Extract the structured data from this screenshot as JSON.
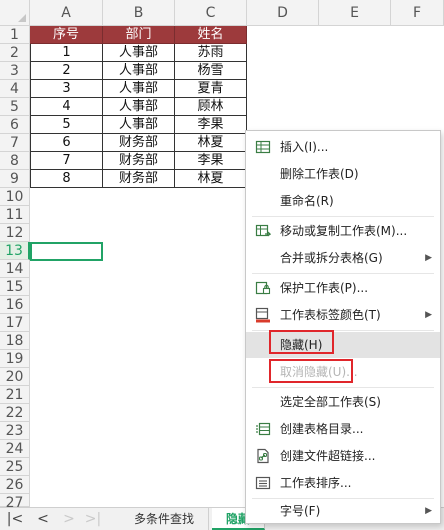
{
  "columns": [
    "A",
    "B",
    "C",
    "D",
    "E",
    "F"
  ],
  "rows": [
    "1",
    "2",
    "3",
    "4",
    "5",
    "6",
    "7",
    "8",
    "9",
    "10",
    "11",
    "12",
    "13",
    "14",
    "15",
    "16",
    "17",
    "18",
    "19",
    "20",
    "21",
    "22",
    "23",
    "24",
    "25",
    "26",
    "27"
  ],
  "table": {
    "headers": [
      "序号",
      "部门",
      "姓名"
    ],
    "rows": [
      [
        "1",
        "人事部",
        "苏雨"
      ],
      [
        "2",
        "人事部",
        "杨雪"
      ],
      [
        "3",
        "人事部",
        "夏青"
      ],
      [
        "4",
        "人事部",
        "顾林"
      ],
      [
        "5",
        "人事部",
        "李果"
      ],
      [
        "6",
        "财务部",
        "林夏"
      ],
      [
        "7",
        "财务部",
        "李果"
      ],
      [
        "8",
        "财务部",
        "林夏"
      ]
    ]
  },
  "tabs": {
    "nav": [
      "|<",
      "<",
      ">",
      ">|"
    ],
    "sheets": [
      "多条件查找",
      "隐藏"
    ]
  },
  "context_menu": {
    "items": [
      {
        "label": "插入(I)...",
        "icon": "insert-sheet-icon"
      },
      {
        "label": "删除工作表(D)",
        "icon": ""
      },
      {
        "label": "重命名(R)",
        "icon": ""
      },
      {
        "label": "移动或复制工作表(M)...",
        "icon": "move-copy-sheet-icon"
      },
      {
        "label": "合并或拆分表格(G)",
        "icon": "",
        "submenu": true
      },
      {
        "label": "保护工作表(P)...",
        "icon": "protect-sheet-icon"
      },
      {
        "label": "工作表标签颜色(T)",
        "icon": "tab-color-icon",
        "submenu": true
      },
      {
        "label": "隐藏(H)",
        "icon": "",
        "state": "hovered"
      },
      {
        "label": "取消隐藏(U)...",
        "icon": "",
        "state": "disabled"
      },
      {
        "label": "选定全部工作表(S)",
        "icon": ""
      },
      {
        "label": "创建表格目录...",
        "icon": "table-directory-icon"
      },
      {
        "label": "创建文件超链接...",
        "icon": "file-hyperlink-icon"
      },
      {
        "label": "工作表排序...",
        "icon": "sort-sheets-icon"
      },
      {
        "label": "字号(F)",
        "icon": "",
        "submenu": true
      }
    ]
  },
  "colors": {
    "header_fill": "#9d3a3c",
    "accent_green": "#21a366",
    "highlight_red": "#e0262b"
  }
}
